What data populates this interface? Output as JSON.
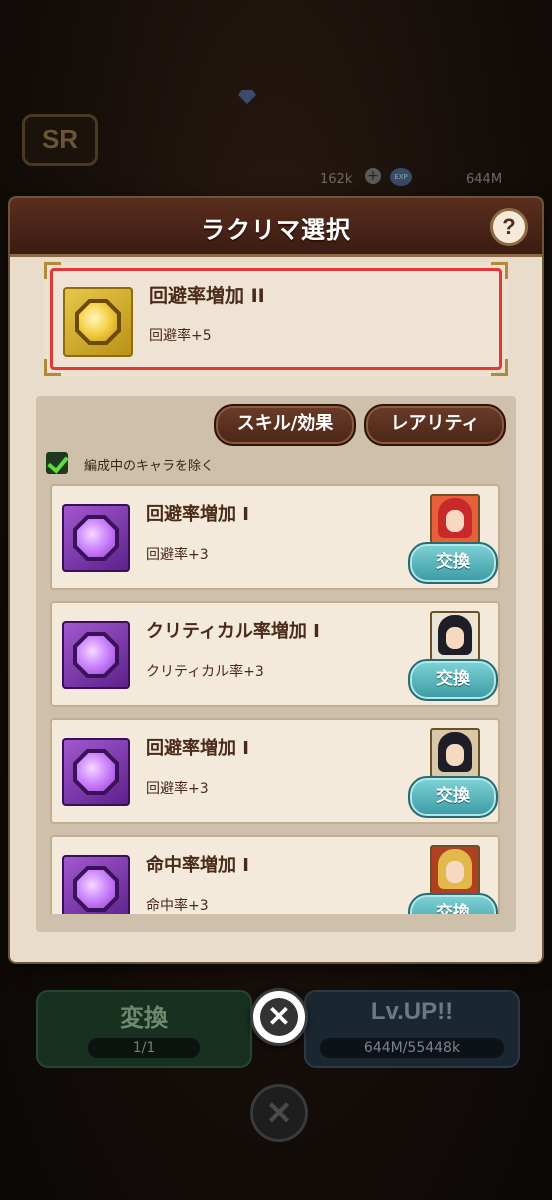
{
  "background": {
    "currency1": "162k",
    "currency2": "644M",
    "rank_badge": "SR",
    "left_button": {
      "label": "変換",
      "sub": "1/1"
    },
    "right_button": {
      "label": "Lv.UP!!",
      "sub": "644M/55448k"
    }
  },
  "dialog": {
    "title": "ラクリマ選択",
    "help": "?",
    "selected": {
      "name": "回避率増加 II",
      "effect": "回避率+5",
      "icon": "gold-lacrima-icon"
    },
    "filters": {
      "skill_label": "スキル/効果",
      "rarity_label": "レアリティ"
    },
    "exclude_label": "編成中のキャラを除く",
    "exclude_checked": true,
    "items": [
      {
        "name": "回避率増加 I",
        "effect": "回避率+3",
        "button": "交換",
        "portrait_hair": "#c82a2a"
      },
      {
        "name": "クリティカル率増加 I",
        "effect": "クリティカル率+3",
        "button": "交換",
        "portrait_hair": "#1e1e28"
      },
      {
        "name": "回避率増加 I",
        "effect": "回避率+3",
        "button": "交換",
        "portrait_hair": "#1e1e28"
      },
      {
        "name": "命中率増加 I",
        "effect": "命中率+3",
        "button": "交換",
        "portrait_hair": "#e3b84a"
      }
    ]
  },
  "close_icon": "close-icon"
}
